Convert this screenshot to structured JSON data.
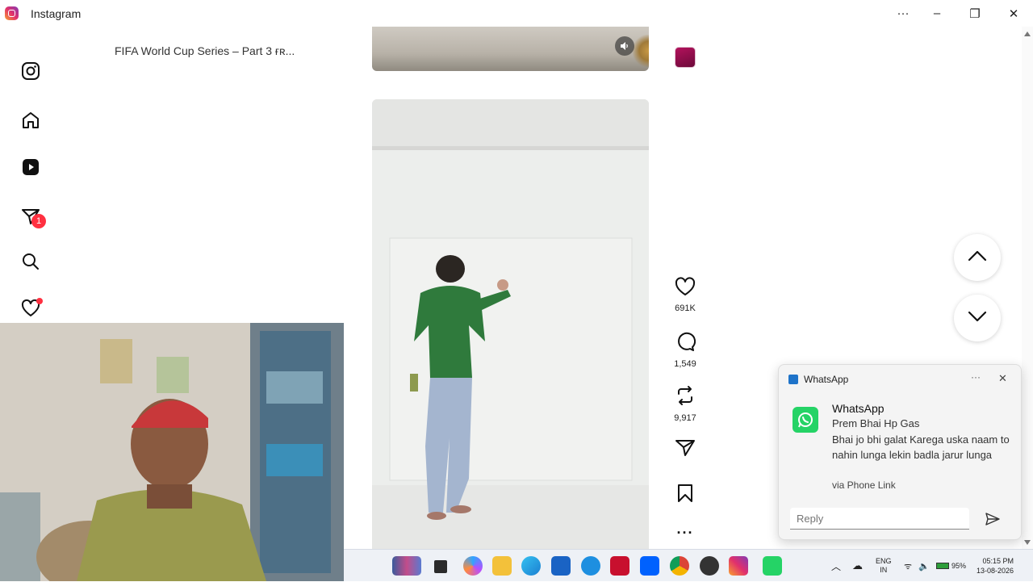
{
  "window": {
    "title": "Instagram",
    "controls": {
      "more": "···",
      "minimize": "–",
      "restore": "❐",
      "close": "✕"
    }
  },
  "sidebar": {
    "items": [
      {
        "name": "instagram-logo-icon"
      },
      {
        "name": "home-icon"
      },
      {
        "name": "reels-icon"
      },
      {
        "name": "messages-icon",
        "badge": "1"
      },
      {
        "name": "search-icon"
      },
      {
        "name": "notifications-icon"
      }
    ]
  },
  "feed": {
    "previous_post": {
      "caption": "FIFA World Cup Series – Part 3 ғʀ..."
    },
    "current_post": {
      "likes": "691K",
      "comments": "1,549",
      "reposts": "9,917",
      "more": "···"
    }
  },
  "notification": {
    "header_app": "WhatsApp",
    "more": "···",
    "close": "✕",
    "app_name": "WhatsApp",
    "sender": "Prem Bhai Hp Gas",
    "message": "Bhai jo bhi galat Karega uska naam to nahin lunga lekin badla jarur lunga",
    "via": "via Phone Link",
    "reply_placeholder": "Reply"
  },
  "taskbar": {
    "language_line1": "ENG",
    "language_line2": "IN",
    "battery": "95%",
    "time": "05:15 PM",
    "date": "13-08-2026"
  },
  "colors": {
    "badge_red": "#ff3040",
    "whatsapp_green": "#25d366",
    "sweater_green": "#2f7a3c"
  }
}
